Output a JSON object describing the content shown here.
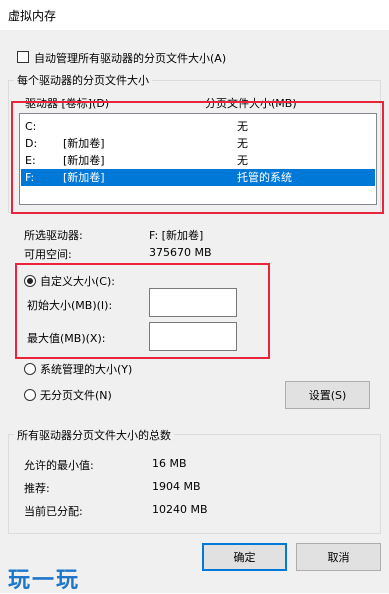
{
  "window": {
    "title": "虚拟内存"
  },
  "auto_manage": {
    "label": "自动管理所有驱动器的分页文件大小(A)",
    "checked": false
  },
  "per_drive": {
    "group_label": "每个驱动器的分页文件大小",
    "header_drive": "驱动器 [卷标](D)",
    "header_size": "分页文件大小(MB)",
    "drives": [
      {
        "drive": "C:",
        "label": "",
        "size": "无"
      },
      {
        "drive": "D:",
        "label": "[新加卷]",
        "size": "无"
      },
      {
        "drive": "E:",
        "label": "[新加卷]",
        "size": "无"
      },
      {
        "drive": "F:",
        "label": "[新加卷]",
        "size": "托管的系统"
      }
    ],
    "selected_index": 3
  },
  "selected_drive": {
    "label": "所选驱动器:",
    "value": "F:  [新加卷]",
    "space_label": "可用空间:",
    "space_value": "375670 MB"
  },
  "custom": {
    "label": "自定义大小(C):",
    "initial_label": "初始大小(MB)(I):",
    "initial_value": "",
    "max_label": "最大值(MB)(X):",
    "max_value": ""
  },
  "system_managed": {
    "label": "系统管理的大小(Y)"
  },
  "no_paging": {
    "label": "无分页文件(N)"
  },
  "set_button": "设置(S)",
  "totals": {
    "group_label": "所有驱动器分页文件大小的总数",
    "min_label": "允许的最小值:",
    "min_value": "16 MB",
    "rec_label": "推荐:",
    "rec_value": "1904 MB",
    "cur_label": "当前已分配:",
    "cur_value": "10240 MB"
  },
  "ok_button": "确定",
  "cancel_button": "取消",
  "watermark": "玩一玩",
  "colors": {
    "selection": "#0078d7",
    "highlight_box": "#e8253a",
    "watermark": "#1d77c9"
  }
}
